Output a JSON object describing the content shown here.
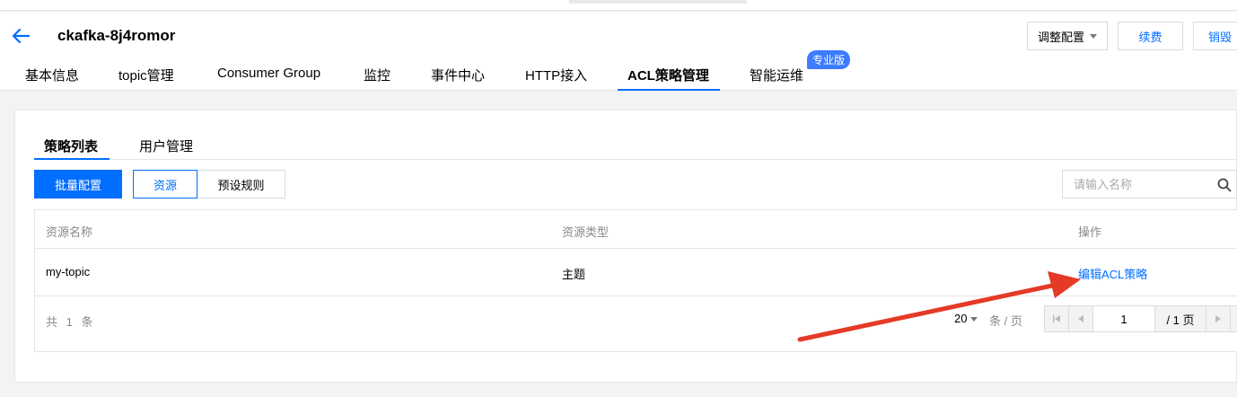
{
  "header": {
    "title": "ckafka-8j4romor",
    "buttons": {
      "adjust": "调整配置",
      "renew": "续费",
      "destroy": "销毁"
    }
  },
  "nav": {
    "tabs": [
      "基本信息",
      "topic管理",
      "Consumer Group",
      "监控",
      "事件中心",
      "HTTP接入",
      "ACL策略管理",
      "智能运维"
    ],
    "active": "ACL策略管理",
    "badge": "专业版"
  },
  "subtabs": [
    "策略列表",
    "用户管理"
  ],
  "toolbar": {
    "batch_config": "批量配置",
    "segment": [
      "资源",
      "预设规则"
    ],
    "search_placeholder": "请输入名称"
  },
  "table": {
    "columns": [
      "资源名称",
      "资源类型",
      "操作"
    ],
    "rows": [
      {
        "name": "my-topic",
        "type": "主题",
        "action": "编辑ACL策略"
      }
    ],
    "total": "共 1 条",
    "page_size": "20",
    "per_page_label": "条 / 页",
    "current_page": "1",
    "total_pages": "/ 1 页"
  },
  "colors": {
    "accent": "#006eff",
    "annotation_arrow": "#e53a26",
    "badge": "#3d7bff"
  },
  "icons": [
    "back-arrow-icon",
    "search-icon",
    "first-page-icon",
    "prev-page-icon",
    "next-page-icon",
    "last-page-icon"
  ]
}
